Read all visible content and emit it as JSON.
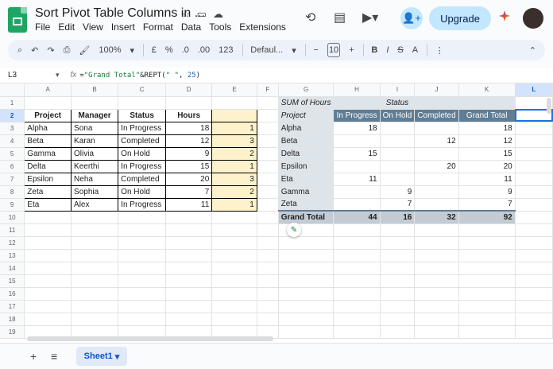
{
  "title": "Sort Pivot Table Columns in ...",
  "menu": [
    "File",
    "Edit",
    "View",
    "Insert",
    "Format",
    "Data",
    "Tools",
    "Extensions"
  ],
  "upgrade_label": "Upgrade",
  "toolbar": {
    "zoom": "100%",
    "currency": "£",
    "percent": "%",
    "dec_less": ".0",
    "dec_more": ".00",
    "format_123": "123",
    "font": "Defaul...",
    "font_size": "10",
    "bold": "B",
    "italic": "I",
    "strike": "S",
    "text_color": "A"
  },
  "formula_bar": {
    "cell_ref": "L3",
    "fx": "fx",
    "formula_pre": "=",
    "formula_s1": "\"Grand Total\"",
    "formula_mid": "&REPT(",
    "formula_s2": "\" \"",
    "formula_mid2": ", ",
    "formula_n": "25",
    "formula_end": ")"
  },
  "columns": [
    "A",
    "B",
    "C",
    "D",
    "E",
    "F",
    "G",
    "H",
    "I",
    "J",
    "K",
    "L"
  ],
  "rows": [
    "1",
    "2",
    "3",
    "4",
    "5",
    "6",
    "7",
    "8",
    "9",
    "10",
    "11",
    "12",
    "13",
    "14",
    "15",
    "16",
    "17",
    "18",
    "19"
  ],
  "source_table": {
    "headers": [
      "Project",
      "Manager",
      "Status",
      "Hours"
    ],
    "rows": [
      [
        "Alpha",
        "Sona",
        "In Progress",
        "18",
        "1"
      ],
      [
        "Beta",
        "Karan",
        "Completed",
        "12",
        "3"
      ],
      [
        "Gamma",
        "Olivia",
        "On Hold",
        "9",
        "2"
      ],
      [
        "Delta",
        "Keerthi",
        "In Progress",
        "15",
        "1"
      ],
      [
        "Epsilon",
        "Neha",
        "Completed",
        "20",
        "3"
      ],
      [
        "Zeta",
        "Sophia",
        "On Hold",
        "7",
        "2"
      ],
      [
        "Eta",
        "Alex",
        "In Progress",
        "11",
        "1"
      ]
    ]
  },
  "pivot": {
    "sum_label": "SUM of Hours",
    "status_label": "Status",
    "project_label": "Project",
    "col_headers": [
      "In Progress",
      "On Hold",
      "Completed",
      "Grand Total"
    ],
    "rows": [
      [
        "Alpha",
        "18",
        "",
        "",
        "18"
      ],
      [
        "Beta",
        "",
        "",
        "12",
        "12"
      ],
      [
        "Delta",
        "15",
        "",
        "",
        "15"
      ],
      [
        "Epsilon",
        "",
        "",
        "20",
        "20"
      ],
      [
        "Eta",
        "11",
        "",
        "",
        "11"
      ],
      [
        "Gamma",
        "",
        "9",
        "",
        "9"
      ],
      [
        "Zeta",
        "",
        "7",
        "",
        "7"
      ]
    ],
    "total": [
      "Grand Total",
      "44",
      "16",
      "32",
      "92"
    ]
  },
  "sheet_tab": "Sheet1"
}
